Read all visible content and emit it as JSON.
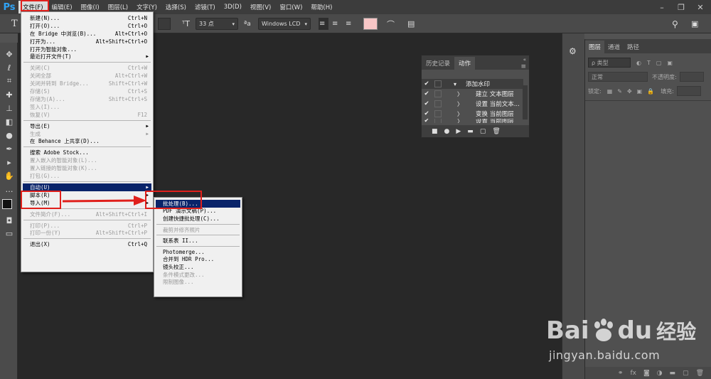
{
  "app": {
    "logo": "Ps"
  },
  "menubar": [
    "文件(F)",
    "编辑(E)",
    "图像(I)",
    "图层(L)",
    "文字(Y)",
    "选择(S)",
    "滤镜(T)",
    "3D(D)",
    "视图(V)",
    "窗口(W)",
    "帮助(H)"
  ],
  "options_bar": {
    "tool_icon": "T",
    "font_size": "33 点",
    "aa_label": "ªa",
    "aa_mode": "Windows LCD",
    "text_color": "#f7c6c6"
  },
  "file_menu": [
    {
      "label": "新建(N)...",
      "shortcut": "Ctrl+N"
    },
    {
      "label": "打开(O)...",
      "shortcut": "Ctrl+O"
    },
    {
      "label": "在 Bridge 中浏览(B)...",
      "shortcut": "Alt+Ctrl+O"
    },
    {
      "label": "打开为...",
      "shortcut": "Alt+Shift+Ctrl+O"
    },
    {
      "label": "打开为智能对象..."
    },
    {
      "label": "最近打开文件(T)",
      "submenu": true
    },
    {
      "sep": true
    },
    {
      "label": "关闭(C)",
      "shortcut": "Ctrl+W",
      "disabled": true
    },
    {
      "label": "关闭全部",
      "shortcut": "Alt+Ctrl+W",
      "disabled": true
    },
    {
      "label": "关闭并转到 Bridge...",
      "shortcut": "Shift+Ctrl+W",
      "disabled": true
    },
    {
      "label": "存储(S)",
      "shortcut": "Ctrl+S",
      "disabled": true
    },
    {
      "label": "存储为(A)...",
      "shortcut": "Shift+Ctrl+S",
      "disabled": true
    },
    {
      "label": "签入(I)...",
      "disabled": true
    },
    {
      "label": "恢复(V)",
      "shortcut": "F12",
      "disabled": true
    },
    {
      "sep": true
    },
    {
      "label": "导出(E)",
      "submenu": true
    },
    {
      "label": "生成",
      "submenu": true,
      "disabled": true
    },
    {
      "label": "在 Behance 上共享(D)..."
    },
    {
      "sep": true
    },
    {
      "label": "搜索 Adobe Stock..."
    },
    {
      "label": "置入嵌入的智能对象(L)...",
      "disabled": true
    },
    {
      "label": "置入链接的智能对象(K)...",
      "disabled": true
    },
    {
      "label": "打包(G)...",
      "disabled": true
    },
    {
      "sep": true
    },
    {
      "label": "自动(U)",
      "submenu": true,
      "highlighted": true
    },
    {
      "label": "脚本(R)",
      "submenu": true
    },
    {
      "label": "导入(M)",
      "submenu": true
    },
    {
      "sep": true
    },
    {
      "label": "文件简介(F)...",
      "shortcut": "Alt+Shift+Ctrl+I",
      "disabled": true
    },
    {
      "sep": true
    },
    {
      "label": "打印(P)...",
      "shortcut": "Ctrl+P",
      "disabled": true
    },
    {
      "label": "打印一份(Y)",
      "shortcut": "Alt+Shift+Ctrl+P",
      "disabled": true
    },
    {
      "sep": true
    },
    {
      "label": "退出(X)",
      "shortcut": "Ctrl+Q"
    }
  ],
  "auto_submenu": [
    {
      "label": "批处理(B)...",
      "highlighted": true
    },
    {
      "label": "PDF 演示文稿(P)..."
    },
    {
      "label": "创建快捷批处理(C)..."
    },
    {
      "sep": true
    },
    {
      "label": "裁剪并修齐照片",
      "disabled": true
    },
    {
      "sep": true
    },
    {
      "label": "联系表 II..."
    },
    {
      "sep": true
    },
    {
      "label": "Photomerge..."
    },
    {
      "label": "合并到 HDR Pro..."
    },
    {
      "label": "镜头校正..."
    },
    {
      "label": "条件模式更改...",
      "disabled": true
    },
    {
      "label": "限制图像...",
      "disabled": true
    }
  ],
  "actions_panel": {
    "tabs": [
      "历史记录",
      "动作"
    ],
    "set_name": "添加水印",
    "steps": [
      "建立 文本图层",
      "设置 当前文本...",
      "变换 当前图层",
      "设置 当前图层"
    ]
  },
  "layers_panel": {
    "tabs": [
      "图层",
      "通道",
      "路径"
    ],
    "filter_label": "ρ 类型",
    "blend_mode": "正常",
    "opacity_label": "不透明度:",
    "lock_label": "锁定:",
    "fill_label": "填充:"
  },
  "watermark": {
    "brand": "Bai",
    "brand2": "du",
    "cn": "经验",
    "url": "jingyan.baidu.com"
  }
}
